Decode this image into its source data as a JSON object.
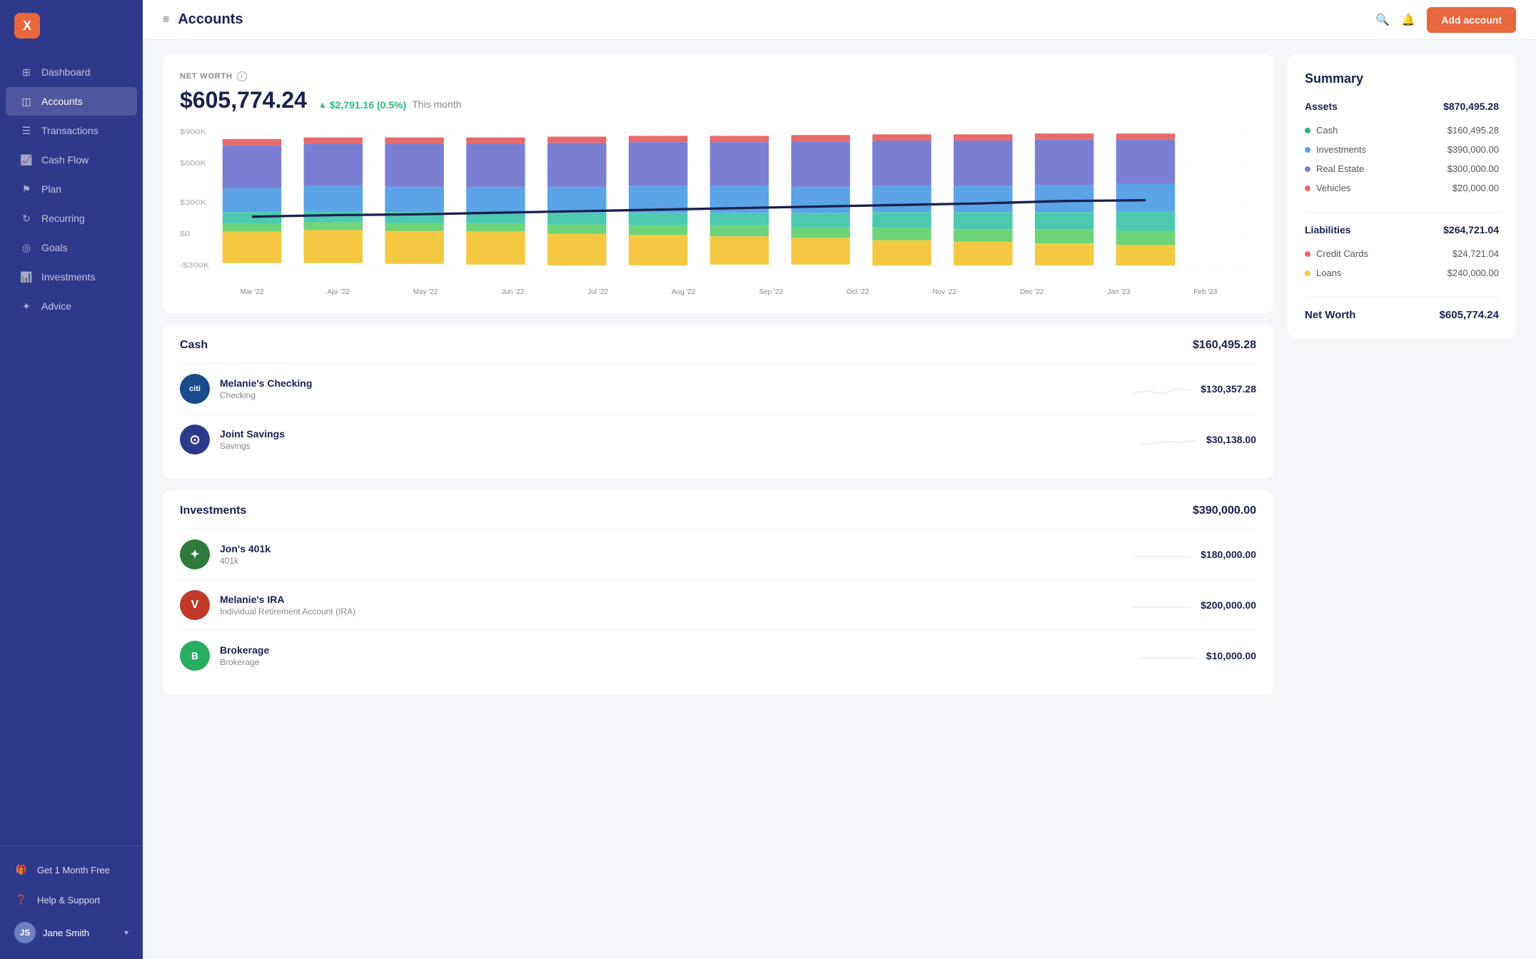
{
  "sidebar": {
    "logo_text": "X",
    "nav_items": [
      {
        "id": "dashboard",
        "label": "Dashboard",
        "icon": "grid"
      },
      {
        "id": "accounts",
        "label": "Accounts",
        "icon": "layers",
        "active": true
      },
      {
        "id": "transactions",
        "label": "Transactions",
        "icon": "list"
      },
      {
        "id": "cashflow",
        "label": "Cash Flow",
        "icon": "trending"
      },
      {
        "id": "plan",
        "label": "Plan",
        "icon": "flag"
      },
      {
        "id": "recurring",
        "label": "Recurring",
        "icon": "refresh"
      },
      {
        "id": "goals",
        "label": "Goals",
        "icon": "target"
      },
      {
        "id": "investments",
        "label": "Investments",
        "icon": "chart"
      },
      {
        "id": "advice",
        "label": "Advice",
        "icon": "star"
      }
    ],
    "promo_label": "Get 1 Month Free",
    "support_label": "Help & Support",
    "user_name": "Jane Smith",
    "user_initials": "JS"
  },
  "topbar": {
    "menu_icon": "≡",
    "title": "Accounts",
    "search_icon": "🔍",
    "bell_icon": "🔔",
    "add_account_label": "Add account"
  },
  "net_worth": {
    "label": "NET WORTH",
    "value": "$605,774.24",
    "change": "$2,791.16 (0.5%)",
    "period": "This month"
  },
  "chart": {
    "y_labels": [
      "$900K",
      "$600K",
      "$300K",
      "$0",
      "-$300K"
    ],
    "x_labels": [
      "Mar '22",
      "Apr '22",
      "May '22",
      "Jun '22",
      "Jul '22",
      "Aug '22",
      "Sep '22",
      "Oct '22",
      "Nov '22",
      "Dec '22",
      "Jan '23",
      "Feb '23"
    ],
    "colors": {
      "purple": "#7b7fd4",
      "blue": "#5ba4e8",
      "teal": "#4dc9b0",
      "green": "#6dd47a",
      "yellow": "#f5c842",
      "red": "#e86a6a"
    }
  },
  "cash_section": {
    "title": "Cash",
    "total": "$160,495.28",
    "accounts": [
      {
        "name": "Melanie's Checking",
        "type": "Checking",
        "balance": "$130,357.28",
        "logo_bg": "#1a4b8c",
        "logo_text": "citi",
        "logo_color": "white"
      },
      {
        "name": "Joint Savings",
        "type": "Savings",
        "balance": "$30,138.00",
        "logo_bg": "#2d3a8c",
        "logo_text": "⊙",
        "logo_color": "white"
      }
    ]
  },
  "investments_section": {
    "title": "Investments",
    "total": "$390,000.00",
    "accounts": [
      {
        "name": "Jon's 401k",
        "type": "401k",
        "balance": "$180,000.00",
        "logo_bg": "#2d7a3a",
        "logo_text": "✦",
        "logo_color": "white"
      },
      {
        "name": "Melanie's IRA",
        "type": "Individual Retirement Account (IRA)",
        "balance": "$200,000.00",
        "logo_bg": "#c0392b",
        "logo_text": "V",
        "logo_color": "white"
      },
      {
        "name": "Brokerage",
        "type": "Brokerage",
        "balance": "$10,000.00",
        "logo_bg": "#2ecc71",
        "logo_text": "B",
        "logo_color": "white"
      }
    ]
  },
  "summary": {
    "title": "Summary",
    "assets_label": "Assets",
    "assets_total": "$870,495.28",
    "liabilities_label": "Liabilities",
    "liabilities_total": "$264,721.04",
    "net_worth_label": "Net Worth",
    "net_worth_value": "$605,774.24",
    "asset_rows": [
      {
        "label": "Cash",
        "value": "$160,495.28",
        "color": "#2db87e"
      },
      {
        "label": "Investments",
        "value": "$390,000.00",
        "color": "#5ba4e8"
      },
      {
        "label": "Real Estate",
        "value": "$300,000.00",
        "color": "#7b7fd4"
      },
      {
        "label": "Vehicles",
        "value": "$20,000.00",
        "color": "#e86a6a"
      }
    ],
    "liability_rows": [
      {
        "label": "Credit Cards",
        "value": "$24,721.04",
        "color": "#e86a6a"
      },
      {
        "label": "Loans",
        "value": "$240,000.00",
        "color": "#f5c842"
      }
    ]
  }
}
